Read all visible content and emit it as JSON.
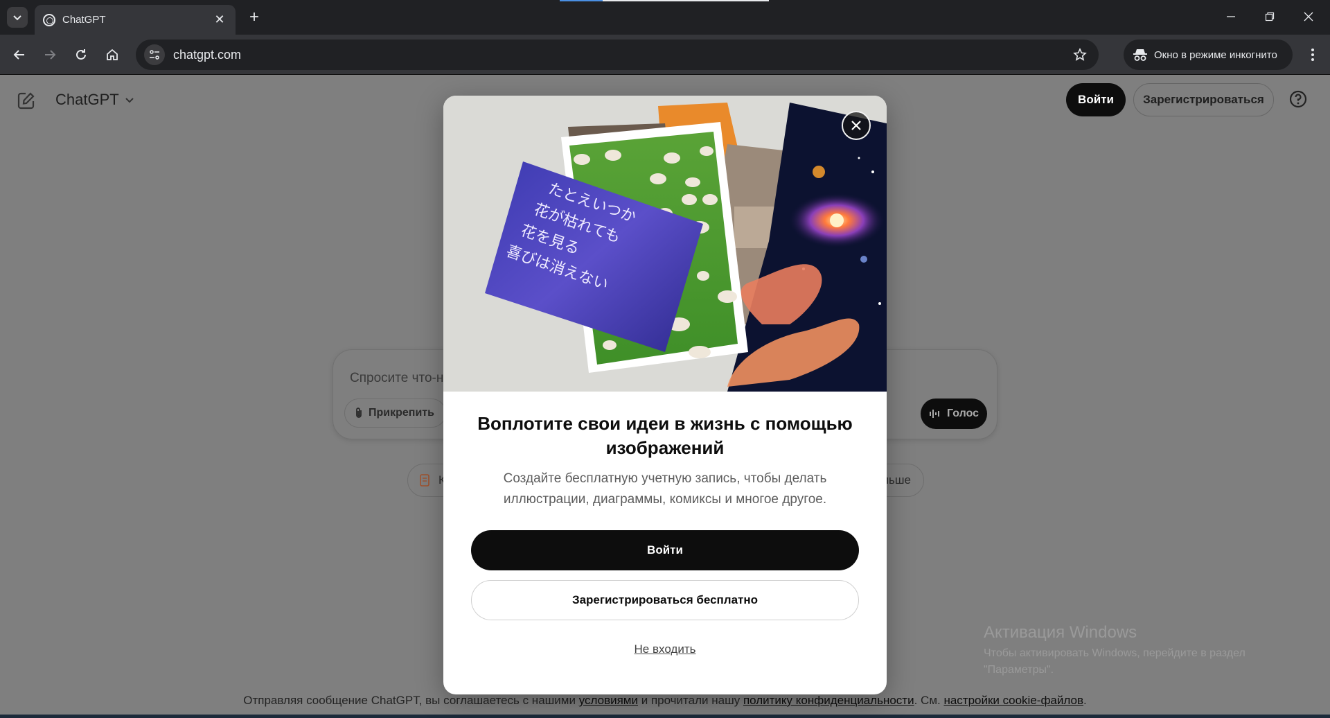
{
  "browser": {
    "tab_title": "ChatGPT",
    "url": "chatgpt.com",
    "incognito_label": "Окно в режиме инкогнито"
  },
  "header": {
    "brand": "ChatGPT",
    "login": "Войти",
    "signup": "Зарегистрироваться"
  },
  "composer": {
    "placeholder": "Спросите что-н",
    "attach": "Прикрепить",
    "voice": "Голос"
  },
  "chips": {
    "left_visible": "К",
    "right_visible": "льше"
  },
  "modal": {
    "title": "Воплотите свои идеи в жизнь с помощью изображений",
    "subtitle": "Создайте бесплатную учетную запись, чтобы делать иллюстрации, диаграммы, комиксы и многое другое.",
    "primary": "Войти",
    "secondary": "Зарегистрироваться бесплатно",
    "skip": "Не входить",
    "poem_lines": [
      "たとえいつか",
      "花が枯れても",
      "花を見る",
      "喜びは消えない"
    ]
  },
  "footer": {
    "text1": "Отправляя сообщение ChatGPT, вы соглашаетесь с нашими ",
    "link_terms": "условиями",
    "text2": " и прочитали нашу ",
    "link_privacy": "политику конфиденциальности",
    "text3": ". См. ",
    "link_cookies": "настройки cookie-файлов",
    "text4": "."
  },
  "watermark": {
    "title": "Активация Windows",
    "line1": "Чтобы активировать Windows, перейдите в раздел",
    "line2": "\"Параметры\"."
  },
  "colors": {
    "accent_black": "#0d0d0d",
    "chrome_dark": "#202124",
    "overlay_gray": "#7f7f7f"
  }
}
